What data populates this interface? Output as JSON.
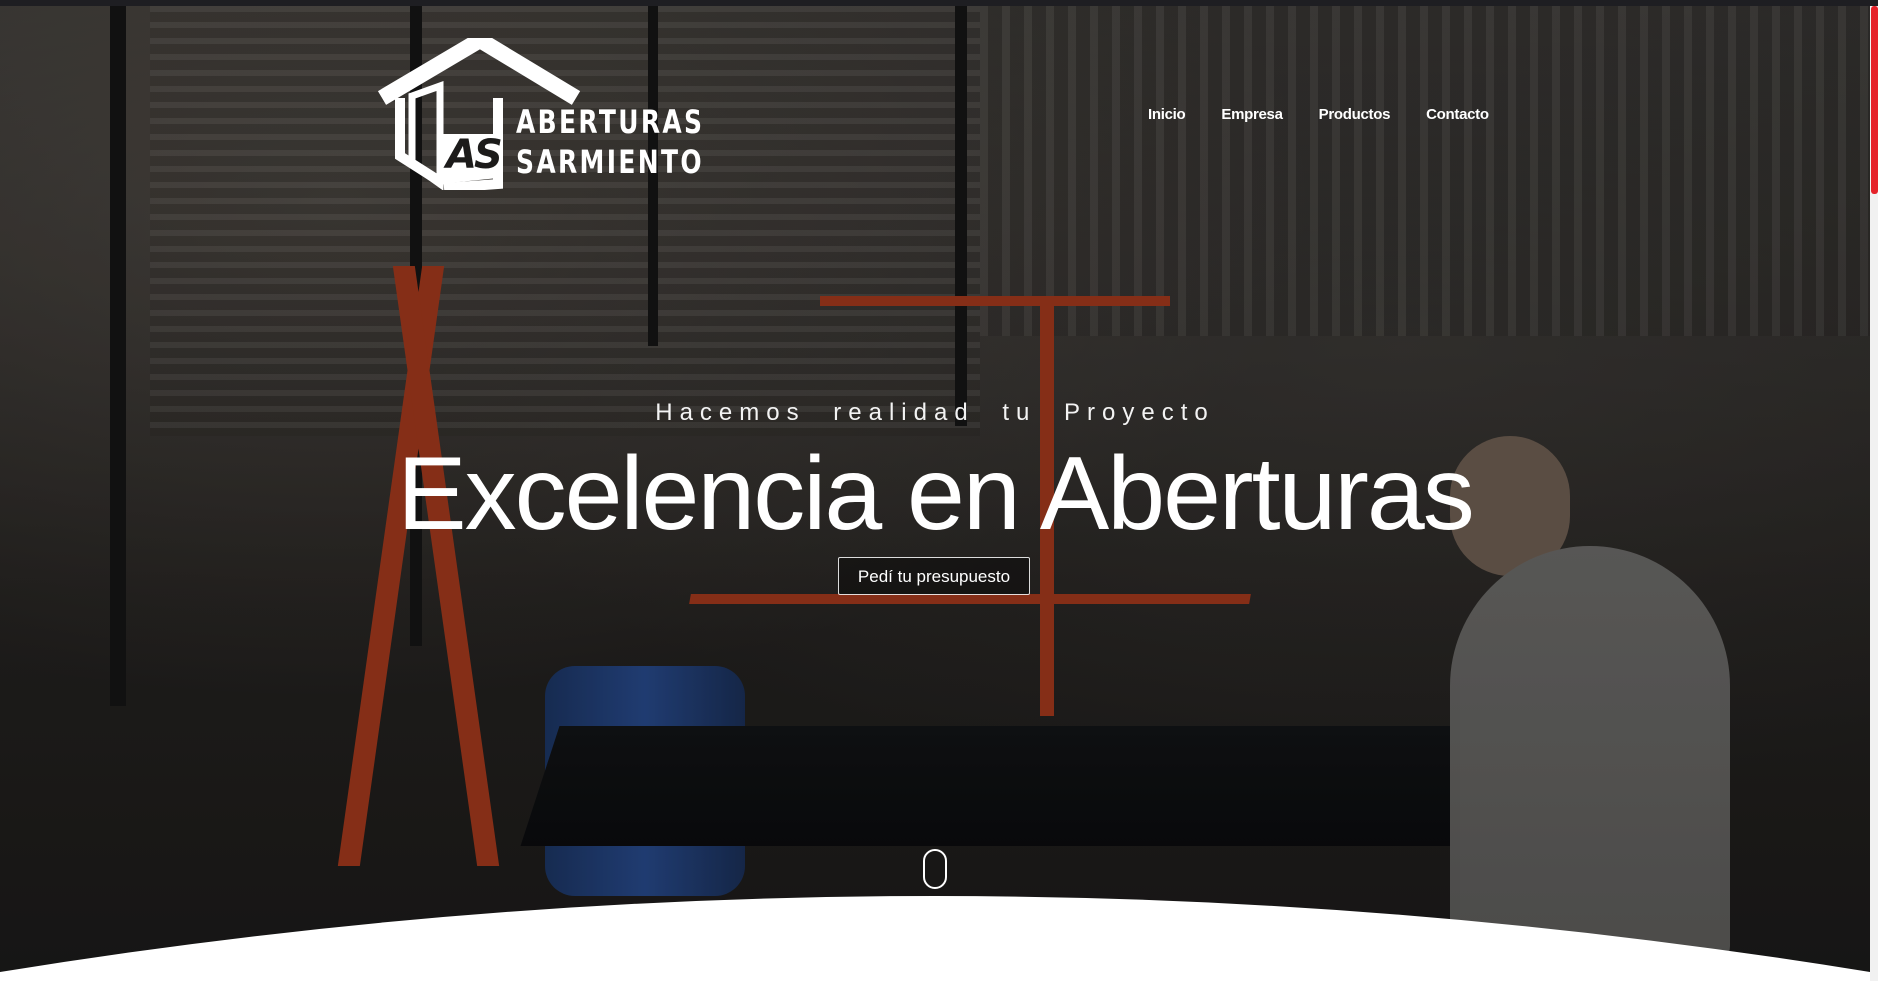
{
  "brand": {
    "line1": "ABERTURAS",
    "line2": "SARMIENTO",
    "mark": "AS"
  },
  "nav": {
    "items": [
      {
        "label": "Inicio"
      },
      {
        "label": "Empresa"
      },
      {
        "label": "Productos"
      },
      {
        "label": "Contacto"
      }
    ]
  },
  "hero": {
    "tagline": "Hacemos realidad tu Proyecto",
    "headline": "Excelencia en Aberturas",
    "cta_label": "Pedí tu presupuesto"
  },
  "colors": {
    "accent": "#e5222a",
    "text": "#ffffff",
    "background": "#ffffff"
  },
  "icons": {
    "logo": "house-logo-icon",
    "scroll": "scroll-mouse-icon"
  }
}
